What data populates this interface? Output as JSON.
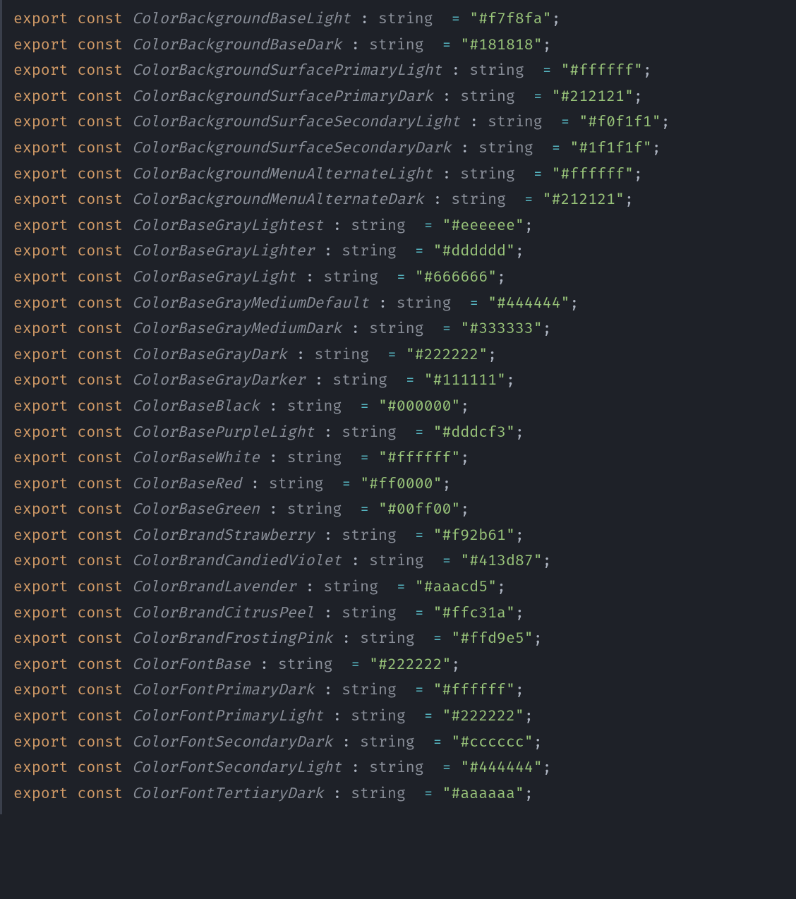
{
  "tokens": {
    "export": "export",
    "const": "const",
    "type": "string",
    "eq": "=",
    "semi": ";"
  },
  "declarations": [
    {
      "name": "ColorBackgroundBaseLight",
      "value": "\"#f7f8fa\""
    },
    {
      "name": "ColorBackgroundBaseDark",
      "value": "\"#181818\""
    },
    {
      "name": "ColorBackgroundSurfacePrimaryLight",
      "value": "\"#ffffff\""
    },
    {
      "name": "ColorBackgroundSurfacePrimaryDark",
      "value": "\"#212121\""
    },
    {
      "name": "ColorBackgroundSurfaceSecondaryLight",
      "value": "\"#f0f1f1\""
    },
    {
      "name": "ColorBackgroundSurfaceSecondaryDark",
      "value": "\"#1f1f1f\""
    },
    {
      "name": "ColorBackgroundMenuAlternateLight",
      "value": "\"#ffffff\""
    },
    {
      "name": "ColorBackgroundMenuAlternateDark",
      "value": "\"#212121\""
    },
    {
      "name": "ColorBaseGrayLightest",
      "value": "\"#eeeeee\""
    },
    {
      "name": "ColorBaseGrayLighter",
      "value": "\"#dddddd\""
    },
    {
      "name": "ColorBaseGrayLight",
      "value": "\"#666666\""
    },
    {
      "name": "ColorBaseGrayMediumDefault",
      "value": "\"#444444\""
    },
    {
      "name": "ColorBaseGrayMediumDark",
      "value": "\"#333333\""
    },
    {
      "name": "ColorBaseGrayDark",
      "value": "\"#222222\""
    },
    {
      "name": "ColorBaseGrayDarker",
      "value": "\"#111111\""
    },
    {
      "name": "ColorBaseBlack",
      "value": "\"#000000\""
    },
    {
      "name": "ColorBasePurpleLight",
      "value": "\"#dddcf3\""
    },
    {
      "name": "ColorBaseWhite",
      "value": "\"#ffffff\""
    },
    {
      "name": "ColorBaseRed",
      "value": "\"#ff0000\""
    },
    {
      "name": "ColorBaseGreen",
      "value": "\"#00ff00\""
    },
    {
      "name": "ColorBrandStrawberry",
      "value": "\"#f92b61\""
    },
    {
      "name": "ColorBrandCandiedViolet",
      "value": "\"#413d87\""
    },
    {
      "name": "ColorBrandLavender",
      "value": "\"#aaacd5\""
    },
    {
      "name": "ColorBrandCitrusPeel",
      "value": "\"#ffc31a\""
    },
    {
      "name": "ColorBrandFrostingPink",
      "value": "\"#ffd9e5\""
    },
    {
      "name": "ColorFontBase",
      "value": "\"#222222\""
    },
    {
      "name": "ColorFontPrimaryDark",
      "value": "\"#ffffff\""
    },
    {
      "name": "ColorFontPrimaryLight",
      "value": "\"#222222\""
    },
    {
      "name": "ColorFontSecondaryDark",
      "value": "\"#cccccc\""
    },
    {
      "name": "ColorFontSecondaryLight",
      "value": "\"#444444\""
    },
    {
      "name": "ColorFontTertiaryDark",
      "value": "\"#aaaaaa\""
    }
  ]
}
